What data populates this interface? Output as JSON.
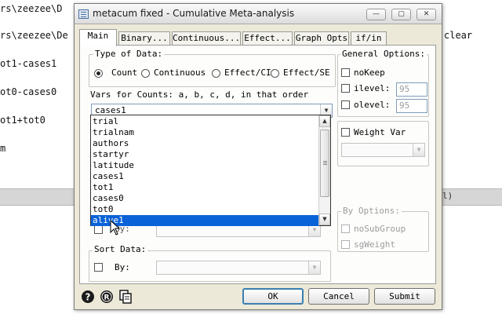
{
  "background": {
    "lines": [
      "rs\\zeezee\\D",
      "rs\\zeezee\\De",
      "ot1-cases1",
      "ot0-cases0",
      "ot1+tot0",
      "m"
    ],
    "clear_text": "clear",
    "paren_text": "l)"
  },
  "dialog": {
    "title": "metacum fixed - Cumulative Meta-analysis",
    "window_buttons": {
      "minimize": "—",
      "maximize": "▢",
      "close": "✕"
    },
    "tabs": [
      "Main",
      "Binary...",
      "Continuous...",
      "Effect...",
      "Graph Opts",
      "if/in"
    ],
    "active_tab": "Main",
    "type_of_data": {
      "label": "Type of Data:",
      "options": [
        "Count",
        "Continuous",
        "Effect/CI",
        "Effect/SE"
      ],
      "selected": "Count"
    },
    "vars_label": "Vars for Counts: a, b, c, d, in that order",
    "vars_combo_value": "cases1",
    "dropdown": {
      "items": [
        "trial",
        "trialnam",
        "authors",
        "startyr",
        "latitude",
        "cases1",
        "tot1",
        "cases0",
        "tot0",
        "alive1"
      ],
      "selected": "alive1"
    },
    "general_options": {
      "label": "General Options:",
      "nokeep_label": "noKeep",
      "ilevel_label": "ilevel:",
      "ilevel_value": "95",
      "olevel_label": "olevel:",
      "olevel_value": "95"
    },
    "weight_var": {
      "label": "Weight Var"
    },
    "by_options": {
      "label": "By Options:",
      "nosubgroup_label": "noSubGroup",
      "sgweight_label": "sgWeight"
    },
    "covered_by_label": "By:",
    "sort_data": {
      "label": "Sort Data:",
      "by_label": "By:"
    },
    "buttons": {
      "ok": "OK",
      "cancel": "Cancel",
      "submit": "Submit"
    },
    "icon_glyphs": {
      "help": "?",
      "reset": "R",
      "copy": "⎘"
    }
  }
}
